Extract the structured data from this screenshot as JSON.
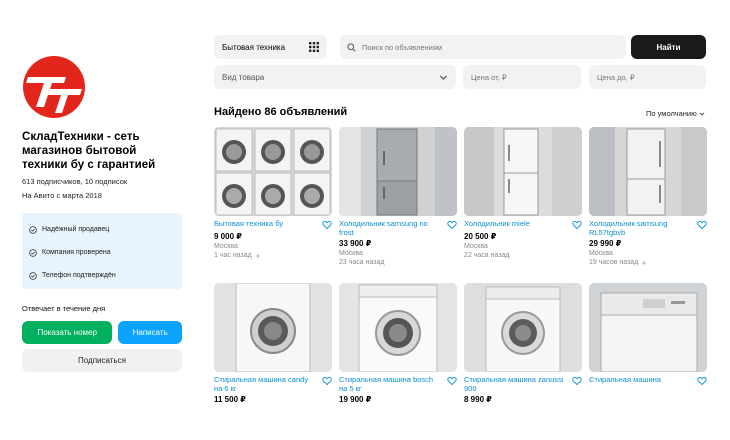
{
  "seller": {
    "name": "СкладТехники - сеть магазинов бытовой техники бу с гарантией",
    "subscribers": "613 подписчиков, 10 подписок",
    "since": "На Авито с марта 2018",
    "badges": [
      {
        "label": "Надёжный продавец",
        "icon": "check-circle-icon"
      },
      {
        "label": "Компания проверена",
        "icon": "check-circle-icon"
      },
      {
        "label": "Телефон подтверждён",
        "icon": "check-circle-icon"
      }
    ],
    "reply_time": "Отвечает в течение дня",
    "show_phone": "Показать номер",
    "write": "Написать",
    "subscribe": "Подписаться"
  },
  "filters": {
    "category": "Бытовая техника",
    "search_placeholder": "Поиск по объявлениям",
    "find": "Найти",
    "item_type": "Вид товара",
    "price_from_placeholder": "Цена от, ₽",
    "price_to_placeholder": "Цена до, ₽"
  },
  "results": {
    "found": "Найдено 86 объявлений",
    "sort": "По умолчанию"
  },
  "colors": {
    "link": "#0a8fd6",
    "green": "#00b05e",
    "blue": "#0aa4ff",
    "logo_red": "#e3261c"
  },
  "listings": [
    {
      "title": "Бытовая техника бу",
      "price": "9 000 ₽",
      "location": "Москва",
      "time": "1 час назад"
    },
    {
      "title": "Холодильник samsung no frost",
      "price": "33 900 ₽",
      "location": "Москва",
      "time": "23 часа назад"
    },
    {
      "title": "Холодильник miele",
      "price": "20 500 ₽",
      "location": "Москва",
      "time": "22 часа назад"
    },
    {
      "title": "Холодильник samsung RL57tgbvb",
      "price": "29 990 ₽",
      "location": "Москва",
      "time": "19 часов назад"
    },
    {
      "title": "Стиральная машина candy на 6 кг",
      "price": "11 500 ₽",
      "location": "",
      "time": ""
    },
    {
      "title": "Стиральная машина bosch на 5 кг",
      "price": "19 900 ₽",
      "location": "",
      "time": ""
    },
    {
      "title": "Стиральная машина zanussi 900",
      "price": "8 990 ₽",
      "location": "",
      "time": ""
    },
    {
      "title": "Стиральная машина",
      "price": "",
      "location": "",
      "time": ""
    }
  ]
}
